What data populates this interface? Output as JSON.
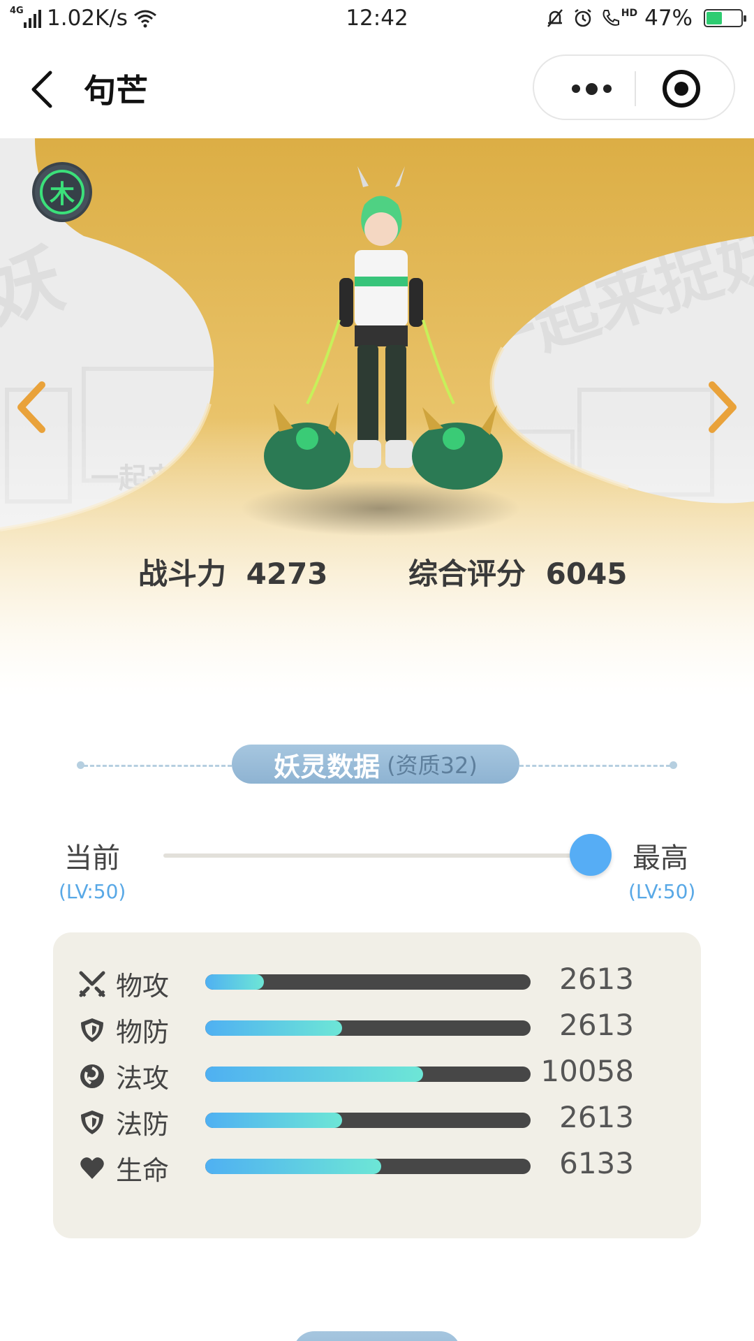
{
  "status_bar": {
    "network": "4G",
    "speed": "1.02K/s",
    "time": "12:42",
    "battery_text": "47%",
    "battery_level": 0.47,
    "hd": "HD"
  },
  "nav": {
    "title": "句芒"
  },
  "hero": {
    "element_char": "木",
    "power_label": "战斗力",
    "power_value": "4273",
    "score_label": "综合评分",
    "score_value": "6045"
  },
  "section": {
    "title": "妖灵数据",
    "quality": "(资质32)"
  },
  "level": {
    "current_label": "当前",
    "current_level": "(LV:50)",
    "max_label": "最高",
    "max_level": "(LV:50)",
    "slider_position": 1.0
  },
  "attributes": [
    {
      "name": "物攻",
      "value": "2613",
      "fill": 0.18,
      "icon": "swords-icon"
    },
    {
      "name": "物防",
      "value": "2613",
      "fill": 0.42,
      "icon": "shield-icon"
    },
    {
      "name": "法攻",
      "value": "10058",
      "fill": 0.67,
      "icon": "magic-swirl-icon"
    },
    {
      "name": "法防",
      "value": "2613",
      "fill": 0.42,
      "icon": "magic-shield-icon"
    },
    {
      "name": "生命",
      "value": "6133",
      "fill": 0.54,
      "icon": "heart-icon"
    }
  ],
  "colors": {
    "accent_blue": "#56adf5",
    "bar_gradient_start": "#4fb0f2",
    "bar_gradient_end": "#6de6d6",
    "hero_gold": "#e2b64e",
    "arrow_orange": "#e9a23a",
    "element_green": "#3be07a"
  }
}
